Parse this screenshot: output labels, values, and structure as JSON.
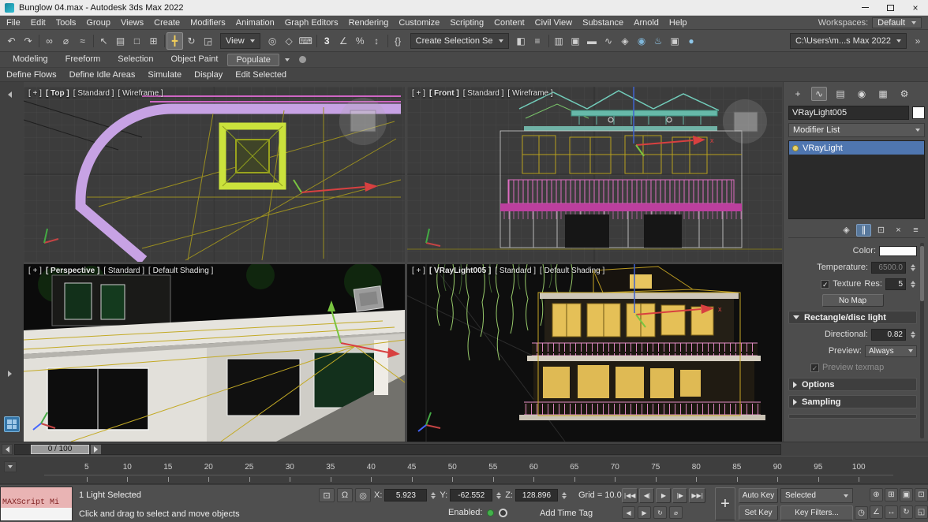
{
  "colors": {
    "active_viewport_border": "#cfa22b",
    "modifier_selected_blue": "#4f76b0",
    "enabled_green": "#43b14b",
    "selection_lime": "#cbe23c"
  },
  "titlebar": {
    "title": "Bunglow 04.max - Autodesk 3ds Max 2022",
    "close_glyph": "×"
  },
  "menubar": {
    "items": [
      "File",
      "Edit",
      "Tools",
      "Group",
      "Views",
      "Create",
      "Modifiers",
      "Animation",
      "Graph Editors",
      "Rendering",
      "Customize",
      "Scripting",
      "Content",
      "Civil View",
      "Substance",
      "Arnold",
      "Help"
    ],
    "workspaces_label": "Workspaces:",
    "workspaces_value": "Default"
  },
  "toolbar": {
    "coord_system_value": "View",
    "selection_set_value": "Create Selection Se",
    "path_value": "C:\\Users\\m...s Max 2022",
    "overflow_glyph": "»",
    "icons_a": [
      {
        "name": "undo-icon",
        "glyph": "↶"
      },
      {
        "name": "redo-icon",
        "glyph": "↷"
      },
      {
        "name": "separator",
        "glyph": "",
        "sep": "1",
        "inter": "false"
      },
      {
        "name": "select-and-link-icon",
        "glyph": "∞"
      },
      {
        "name": "unlink-selection-icon",
        "glyph": "⌀"
      },
      {
        "name": "bind-to-space-warp-icon",
        "glyph": "≈"
      },
      {
        "name": "separator",
        "glyph": "",
        "sep": "1",
        "inter": "false"
      },
      {
        "name": "select-object-icon",
        "glyph": "↖"
      },
      {
        "name": "select-by-name-icon",
        "glyph": "▤"
      },
      {
        "name": "rectangular-selection-region-icon",
        "glyph": "□"
      },
      {
        "name": "window-crossing-icon",
        "glyph": "⊞"
      },
      {
        "name": "separator",
        "glyph": "",
        "sep": "1",
        "inter": "false"
      },
      {
        "name": "select-and-move-icon",
        "glyph": "╋",
        "state": "active"
      },
      {
        "name": "select-and-rotate-icon",
        "glyph": "↻"
      },
      {
        "name": "select-and-scale-icon",
        "glyph": "◲"
      }
    ],
    "icons_b": [
      {
        "name": "use-pivot-center-icon",
        "glyph": "◎"
      },
      {
        "name": "select-and-manipulate-icon",
        "glyph": "◇"
      },
      {
        "name": "keyboard-shortcut-override-icon",
        "glyph": "⌨"
      },
      {
        "name": "separator",
        "glyph": "",
        "sep": "1",
        "inter": "false"
      },
      {
        "name": "snaps-toggle-icon",
        "glyph": "3"
      },
      {
        "name": "angle-snap-icon",
        "glyph": "∠"
      },
      {
        "name": "percent-snap-icon",
        "glyph": "%"
      },
      {
        "name": "spinner-snap-icon",
        "glyph": "↕"
      },
      {
        "name": "separator",
        "glyph": "",
        "sep": "1",
        "inter": "false"
      },
      {
        "name": "named-selection-sets-icon",
        "glyph": "{}"
      }
    ],
    "icons_c": [
      {
        "name": "mirror-icon",
        "glyph": "◧"
      },
      {
        "name": "align-icon",
        "glyph": "≡"
      },
      {
        "name": "separator",
        "glyph": "",
        "sep": "1",
        "inter": "false"
      },
      {
        "name": "scene-explorer-icon",
        "glyph": "▥"
      },
      {
        "name": "layer-manager-icon",
        "glyph": "▣"
      },
      {
        "name": "ribbon-toggle-icon",
        "glyph": "▬"
      },
      {
        "name": "curve-editor-icon",
        "glyph": "∿"
      },
      {
        "name": "schematic-view-icon",
        "glyph": "◈"
      },
      {
        "name": "material-editor-icon",
        "glyph": "◉"
      },
      {
        "name": "render-setup-icon",
        "glyph": "♨"
      },
      {
        "name": "rendered-frame-window-icon",
        "glyph": "▣"
      },
      {
        "name": "render-production-icon",
        "glyph": "●"
      }
    ]
  },
  "ribbon": {
    "tabs": [
      {
        "name": "ribbon-tab-modeling",
        "label": "Modeling"
      },
      {
        "name": "ribbon-tab-freeform",
        "label": "Freeform"
      },
      {
        "name": "ribbon-tab-selection",
        "label": "Selection"
      },
      {
        "name": "ribbon-tab-object-paint",
        "label": "Object Paint"
      },
      {
        "name": "ribbon-tab-populate",
        "label": "Populate",
        "state": "active"
      }
    ],
    "tools": [
      {
        "name": "define-flows-button",
        "label": "Define Flows"
      },
      {
        "name": "define-idle-areas-button",
        "label": "Define Idle Areas"
      },
      {
        "name": "simulate-button",
        "label": "Simulate"
      },
      {
        "name": "display-button",
        "label": "Display"
      },
      {
        "name": "edit-selected-button",
        "label": "Edit Selected"
      }
    ]
  },
  "viewports": {
    "top": {
      "plus": "[ + ]",
      "view": "[ Top ]",
      "renderer": "[ Standard ]",
      "shading": "[ Wireframe ]"
    },
    "front": {
      "plus": "[ + ]",
      "view": "[ Front ]",
      "renderer": "[ Standard ]",
      "shading": "[ Wireframe ]"
    },
    "perspective": {
      "plus": "[ + ]",
      "view": "[ Perspective ]",
      "renderer": "[ Standard ]",
      "shading": "[ Default Shading ]"
    },
    "light": {
      "plus": "[ + ]",
      "view": "[ VRayLight005 ]",
      "renderer": "[ Standard ]",
      "shading": "[ Default Shading ]"
    }
  },
  "command_panel": {
    "tabs": [
      {
        "name": "create-tab-icon",
        "glyph": "+"
      },
      {
        "name": "modify-tab-icon",
        "glyph": "∿",
        "state": "active"
      },
      {
        "name": "hierarchy-tab-icon",
        "glyph": "▤"
      },
      {
        "name": "motion-tab-icon",
        "glyph": "◉"
      },
      {
        "name": "display-tab-icon",
        "glyph": "▦"
      },
      {
        "name": "utilities-tab-icon",
        "glyph": "⚙"
      }
    ],
    "object_name": "VRayLight005",
    "modifier_list_label": "Modifier List",
    "stack_item": "VRayLight",
    "stack_tools": [
      {
        "name": "pin-stack-icon",
        "glyph": "◈"
      },
      {
        "name": "show-end-result-icon",
        "glyph": "∥",
        "state": "active"
      },
      {
        "name": "make-unique-icon",
        "glyph": "⊡"
      },
      {
        "name": "remove-modifier-icon",
        "glyph": "×"
      },
      {
        "name": "configure-modifier-sets-icon",
        "glyph": "≡"
      }
    ],
    "params": {
      "check_glyph": "✓",
      "color_label": "Color:",
      "temperature_label": "Temperature:",
      "temperature_value": "6500.0",
      "texture_label": "Texture",
      "res_label": "Res:",
      "res_value": "5",
      "no_map_label": "No Map",
      "directional_label": "Directional:",
      "directional_value": "0.82",
      "preview_label": "Preview:",
      "preview_value": "Always",
      "preview_texmap_label": "Preview texmap"
    },
    "rollouts": {
      "rect_light": "Rectangle/disc light",
      "options": "Options",
      "sampling": "Sampling"
    }
  },
  "timeline": {
    "handle_label": "0 / 100",
    "ticks": [
      "5",
      "10",
      "15",
      "20",
      "25",
      "30",
      "35",
      "40",
      "45",
      "50",
      "55",
      "60",
      "65",
      "70",
      "75",
      "80",
      "85",
      "90",
      "95",
      "100"
    ]
  },
  "statusbar": {
    "maxscript_label": "MAXScript Mi",
    "status_line": "1 Light Selected",
    "prompt_line": "Click and drag to select and move objects",
    "toggle_icons": [
      {
        "name": "isolate-selection-icon",
        "glyph": "⊡"
      },
      {
        "name": "selection-lock-icon",
        "glyph": "Ω"
      },
      {
        "name": "absolute-mode-icon",
        "glyph": "◎"
      }
    ],
    "x_label": "X:",
    "x_value": "5.923",
    "y_label": "Y:",
    "y_value": "-62.552",
    "z_label": "Z:",
    "z_value": "128.896",
    "grid_label": "Grid = 10.0",
    "playback": [
      {
        "name": "go-to-start-button",
        "glyph": "|◀◀"
      },
      {
        "name": "previous-frame-button",
        "glyph": "◀|"
      },
      {
        "name": "play-button",
        "glyph": "▶"
      },
      {
        "name": "next-frame-button",
        "glyph": "|▶"
      },
      {
        "name": "go-to-end-button",
        "glyph": "▶▶|"
      }
    ],
    "playback2": [
      {
        "name": "previous-key-icon",
        "glyph": "◀"
      },
      {
        "name": "next-key-icon",
        "glyph": "▶"
      },
      {
        "name": "playback-loop-icon",
        "glyph": "↻"
      },
      {
        "name": "key-mode-toggle-icon",
        "glyph": "⌀"
      }
    ],
    "set_keys_glyph": "+",
    "auto_key_label": "Auto Key",
    "set_key_label": "Set Key",
    "keying_target_value": "Selected",
    "key_filters_label": "Key Filters...",
    "enabled_label": "Enabled:",
    "add_time_tag_label": "Add Time Tag",
    "time_config_glyph": "◷",
    "nav1": [
      {
        "name": "zoom-icon",
        "glyph": "⊕"
      },
      {
        "name": "zoom-all-icon",
        "glyph": "⊞"
      },
      {
        "name": "zoom-extents-icon",
        "glyph": "▣"
      },
      {
        "name": "zoom-region-icon",
        "glyph": "⊡"
      }
    ],
    "nav2": [
      {
        "name": "field-of-view-icon",
        "glyph": "∠"
      },
      {
        "name": "pan-icon",
        "glyph": "↔"
      },
      {
        "name": "orbit-icon",
        "glyph": "↻"
      },
      {
        "name": "maximize-viewport-toggle-icon",
        "glyph": "◱"
      }
    ]
  }
}
